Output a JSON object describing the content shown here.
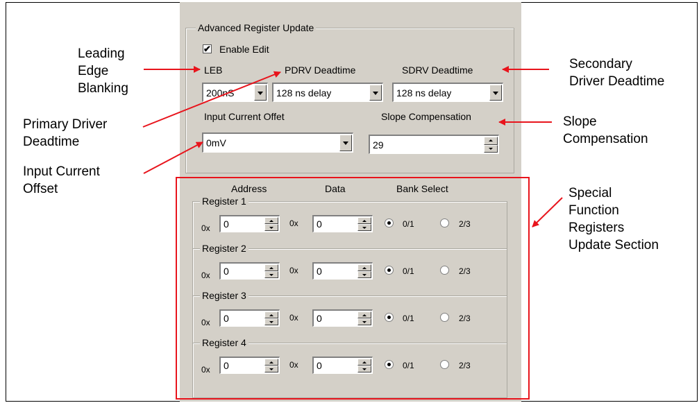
{
  "annotations": {
    "leb": [
      "Leading",
      "Edge",
      "Blanking"
    ],
    "primary": [
      "Primary Driver",
      "Deadtime"
    ],
    "input": [
      "Input Current",
      "Offset"
    ],
    "secondary": [
      "Secondary",
      "Driver Deadtime"
    ],
    "slope": [
      "Slope",
      "Compensation"
    ],
    "sfr": [
      "Special",
      "Function",
      "Registers",
      "Update Section"
    ]
  },
  "panel": {
    "group_title": "Advanced Register Update",
    "enable_edit": {
      "label": "Enable Edit",
      "checked": true,
      "mark": "✔"
    },
    "leb": {
      "label": "LEB",
      "value": "200nS"
    },
    "pdrv": {
      "label": "PDRV Deadtime",
      "value": "128 ns delay"
    },
    "sdrv": {
      "label": "SDRV Deadtime",
      "value": "128 ns delay"
    },
    "input_offset": {
      "label": "Input Current Offet",
      "value": "0mV"
    },
    "slope": {
      "label": "Slope Compensation",
      "value": "29"
    }
  },
  "registers": {
    "headers": {
      "address": "Address",
      "data": "Data",
      "bank": "Bank Select"
    },
    "prefix": "0x",
    "bank_options": [
      "0/1",
      "2/3"
    ],
    "items": [
      {
        "name": "Register 1",
        "address": "0",
        "data": "0",
        "bank": "0/1"
      },
      {
        "name": "Register 2",
        "address": "0",
        "data": "0",
        "bank": "0/1"
      },
      {
        "name": "Register 3",
        "address": "0",
        "data": "0",
        "bank": "0/1"
      },
      {
        "name": "Register 4",
        "address": "0",
        "data": "0",
        "bank": "0/1"
      }
    ]
  },
  "colors": {
    "annotation_red": "#e8141c",
    "dialog_bg": "#d4d0c8"
  }
}
